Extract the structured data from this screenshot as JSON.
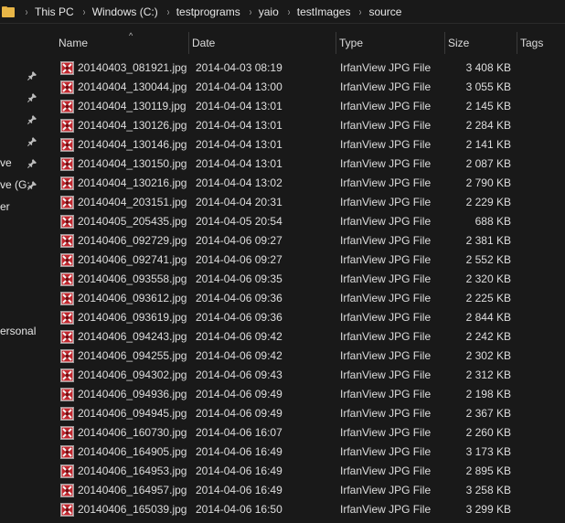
{
  "address": {
    "crumbs": [
      "This PC",
      "Windows (C:)",
      "testprograms",
      "yaio",
      "testImages",
      "source"
    ],
    "separator": "›"
  },
  "nav": {
    "items": [
      {
        "label": "",
        "pinned": true
      },
      {
        "label": "",
        "pinned": true
      },
      {
        "label": "",
        "pinned": true
      },
      {
        "label": "",
        "pinned": true
      },
      {
        "label": "ve",
        "pinned": true
      },
      {
        "label": "ve (G:",
        "pinned": true
      },
      {
        "label": "er",
        "pinned": false
      },
      {
        "label": "ersonal",
        "pinned": false
      }
    ]
  },
  "columns": {
    "name": "Name",
    "date": "Date",
    "type": "Type",
    "size": "Size",
    "tags": "Tags",
    "sort_indicator": "^"
  },
  "files": [
    {
      "name": "20140403_081921.jpg",
      "date": "2014-04-03 08:19",
      "type": "IrfanView JPG File",
      "size": "3 408 KB"
    },
    {
      "name": "20140404_130044.jpg",
      "date": "2014-04-04 13:00",
      "type": "IrfanView JPG File",
      "size": "3 055 KB"
    },
    {
      "name": "20140404_130119.jpg",
      "date": "2014-04-04 13:01",
      "type": "IrfanView JPG File",
      "size": "2 145 KB"
    },
    {
      "name": "20140404_130126.jpg",
      "date": "2014-04-04 13:01",
      "type": "IrfanView JPG File",
      "size": "2 284 KB"
    },
    {
      "name": "20140404_130146.jpg",
      "date": "2014-04-04 13:01",
      "type": "IrfanView JPG File",
      "size": "2 141 KB"
    },
    {
      "name": "20140404_130150.jpg",
      "date": "2014-04-04 13:01",
      "type": "IrfanView JPG File",
      "size": "2 087 KB"
    },
    {
      "name": "20140404_130216.jpg",
      "date": "2014-04-04 13:02",
      "type": "IrfanView JPG File",
      "size": "2 790 KB"
    },
    {
      "name": "20140404_203151.jpg",
      "date": "2014-04-04 20:31",
      "type": "IrfanView JPG File",
      "size": "2 229 KB"
    },
    {
      "name": "20140405_205435.jpg",
      "date": "2014-04-05 20:54",
      "type": "IrfanView JPG File",
      "size": "688 KB"
    },
    {
      "name": "20140406_092729.jpg",
      "date": "2014-04-06 09:27",
      "type": "IrfanView JPG File",
      "size": "2 381 KB"
    },
    {
      "name": "20140406_092741.jpg",
      "date": "2014-04-06 09:27",
      "type": "IrfanView JPG File",
      "size": "2 552 KB"
    },
    {
      "name": "20140406_093558.jpg",
      "date": "2014-04-06 09:35",
      "type": "IrfanView JPG File",
      "size": "2 320 KB"
    },
    {
      "name": "20140406_093612.jpg",
      "date": "2014-04-06 09:36",
      "type": "IrfanView JPG File",
      "size": "2 225 KB"
    },
    {
      "name": "20140406_093619.jpg",
      "date": "2014-04-06 09:36",
      "type": "IrfanView JPG File",
      "size": "2 844 KB"
    },
    {
      "name": "20140406_094243.jpg",
      "date": "2014-04-06 09:42",
      "type": "IrfanView JPG File",
      "size": "2 242 KB"
    },
    {
      "name": "20140406_094255.jpg",
      "date": "2014-04-06 09:42",
      "type": "IrfanView JPG File",
      "size": "2 302 KB"
    },
    {
      "name": "20140406_094302.jpg",
      "date": "2014-04-06 09:43",
      "type": "IrfanView JPG File",
      "size": "2 312 KB"
    },
    {
      "name": "20140406_094936.jpg",
      "date": "2014-04-06 09:49",
      "type": "IrfanView JPG File",
      "size": "2 198 KB"
    },
    {
      "name": "20140406_094945.jpg",
      "date": "2014-04-06 09:49",
      "type": "IrfanView JPG File",
      "size": "2 367 KB"
    },
    {
      "name": "20140406_160730.jpg",
      "date": "2014-04-06 16:07",
      "type": "IrfanView JPG File",
      "size": "2 260 KB"
    },
    {
      "name": "20140406_164905.jpg",
      "date": "2014-04-06 16:49",
      "type": "IrfanView JPG File",
      "size": "3 173 KB"
    },
    {
      "name": "20140406_164953.jpg",
      "date": "2014-04-06 16:49",
      "type": "IrfanView JPG File",
      "size": "2 895 KB"
    },
    {
      "name": "20140406_164957.jpg",
      "date": "2014-04-06 16:49",
      "type": "IrfanView JPG File",
      "size": "3 258 KB"
    },
    {
      "name": "20140406_165039.jpg",
      "date": "2014-04-06 16:50",
      "type": "IrfanView JPG File",
      "size": "3 299 KB"
    }
  ],
  "icons": {
    "file": "irfanview-jpg-file-icon",
    "folder": "folder-icon",
    "pin": "pin-icon"
  },
  "colors": {
    "background": "#191919",
    "text": "#dedede",
    "folder": "#e8b647",
    "file_icon_red": "#c0262d"
  }
}
